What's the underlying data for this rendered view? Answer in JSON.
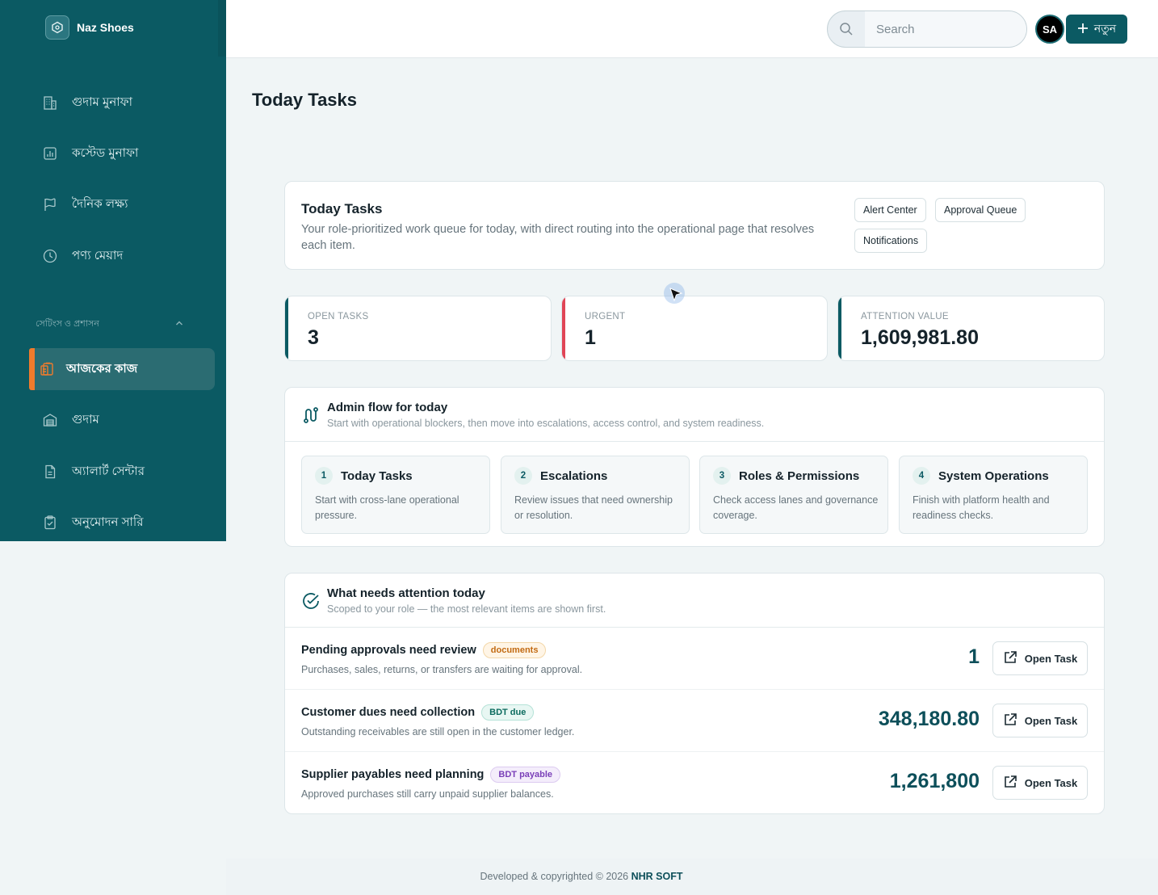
{
  "brand": {
    "name": "Naz Shoes"
  },
  "sidebar": {
    "items_top": [
      {
        "label": "গুদাম মুনাফা",
        "icon": "building-icon"
      },
      {
        "label": "কস্টেড মুনাফা",
        "icon": "bar-chart-icon"
      },
      {
        "label": "দৈনিক লক্ষ্য",
        "icon": "flag-icon"
      },
      {
        "label": "পণ্য মেয়াদ",
        "icon": "clock-icon"
      }
    ],
    "section_label": "সেটিংস ও প্রশাসন",
    "items_bottom": [
      {
        "label": "আজকের কাজ",
        "icon": "clipboard-icon",
        "active": true
      },
      {
        "label": "গুদাম",
        "icon": "warehouse-icon"
      },
      {
        "label": "অ্যালার্ট সেন্টার",
        "icon": "file-icon"
      },
      {
        "label": "অনুমোদন সারি",
        "icon": "clipboard-check-icon"
      }
    ]
  },
  "topbar": {
    "search_placeholder": "Search",
    "avatar_initials": "SA",
    "new_button_label": "নতুন"
  },
  "page": {
    "title": "Today Tasks"
  },
  "hero": {
    "title": "Today Tasks",
    "description": "Your role-prioritized work queue for today, with direct routing into the operational page that resolves each item.",
    "chips": [
      "Alert Center",
      "Approval Queue",
      "Notifications"
    ]
  },
  "stats": [
    {
      "label": "OPEN TASKS",
      "value": "3",
      "accent": "#0b5a63"
    },
    {
      "label": "URGENT",
      "value": "1",
      "accent": "#e04556"
    },
    {
      "label": "ATTENTION VALUE",
      "value": "1,609,981.80",
      "accent": "#0b5a63"
    }
  ],
  "admin_flow": {
    "title": "Admin flow for today",
    "subtitle": "Start with operational blockers, then move into escalations, access control, and system readiness.",
    "steps": [
      {
        "num": "1",
        "title": "Today Tasks",
        "desc": "Start with cross-lane operational pressure."
      },
      {
        "num": "2",
        "title": "Escalations",
        "desc": "Review issues that need ownership or resolution."
      },
      {
        "num": "3",
        "title": "Roles & Permissions",
        "desc": "Check access lanes and governance coverage."
      },
      {
        "num": "4",
        "title": "System Operations",
        "desc": "Finish with platform health and readiness checks."
      }
    ]
  },
  "attention": {
    "title": "What needs attention today",
    "subtitle": "Scoped to your role — the most relevant items are shown first.",
    "open_label": "Open Task",
    "rows": [
      {
        "title": "Pending approvals need review",
        "badge": "documents",
        "badge_color": "#c26a12",
        "badge_bg": "#fff5e6",
        "badge_border": "#f3d7a8",
        "desc": "Purchases, sales, returns, or transfers are waiting for approval.",
        "value": "1"
      },
      {
        "title": "Customer dues need collection",
        "badge": "BDT due",
        "badge_color": "#0b6b5e",
        "badge_bg": "#e8f7f3",
        "badge_border": "#b5e2d7",
        "desc": "Outstanding receivables are still open in the customer ledger.",
        "value": "348,180.80"
      },
      {
        "title": "Supplier payables need planning",
        "badge": "BDT payable",
        "badge_color": "#7a3fb8",
        "badge_bg": "#f4edfb",
        "badge_border": "#dccbf0",
        "desc": "Approved purchases still carry unpaid supplier balances.",
        "value": "1,261,800"
      }
    ]
  },
  "footer": {
    "text": "Developed & copyrighted © 2026",
    "brand": "NHR SOFT"
  }
}
